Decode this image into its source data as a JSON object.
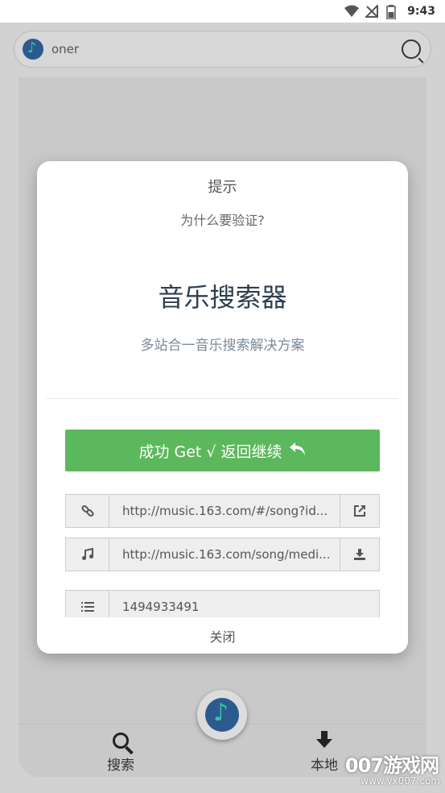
{
  "status_bar": {
    "time": "9:43",
    "icons": [
      "wifi-icon",
      "no-signal-icon",
      "battery-icon"
    ]
  },
  "search": {
    "value": "oner",
    "icon": "search-icon"
  },
  "dialog": {
    "title": "提示",
    "subtitle": "为什么要验证?",
    "heading": "音乐搜索器",
    "description": "多站合一音乐搜索解决方案",
    "success_button": "成功 Get √ 返回继续",
    "link_url": "http://music.163.com/#/song?id...",
    "media_url": "http://music.163.com/song/medi...",
    "song_id": "1494933491",
    "close_label": "关闭"
  },
  "bottom_nav": {
    "search_label": "搜索",
    "local_label": "本地"
  },
  "watermark": {
    "main": "007游戏网",
    "url": "www.yx007.com"
  },
  "colors": {
    "success": "#5cb85c",
    "heading": "#2e3e50",
    "logo_bg": "#2c5a8e",
    "logo_note": "#37c4a0"
  }
}
